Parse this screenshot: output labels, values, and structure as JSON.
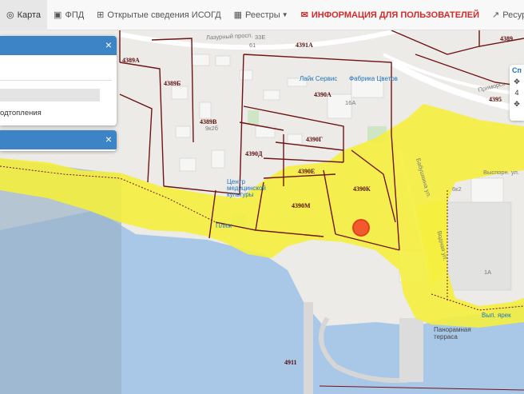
{
  "nav": {
    "items": [
      {
        "label": "Карта",
        "icon": "globe-icon"
      },
      {
        "label": "ФПД",
        "icon": "map-icon"
      },
      {
        "label": "Открытые сведения ИСОГД",
        "icon": "plus-square-icon"
      },
      {
        "label": "Реестры",
        "icon": "table-icon"
      },
      {
        "label": "ИНФОРМАЦИЯ ДЛЯ ПОЛЬЗОВАТЕЛЕЙ",
        "icon": "comments-icon"
      },
      {
        "label": "Ресурсы",
        "icon": "external-link-icon"
      }
    ]
  },
  "panel1": {
    "text": "одтопления",
    "close": "×"
  },
  "panel2": {
    "close": "×"
  },
  "zoom": {
    "label_top": "Сп",
    "label_mid": "4"
  },
  "map": {
    "quarters": [
      "4389А",
      "4389Б",
      "4389В",
      "4390А",
      "4391А",
      "4390Г",
      "4390Д",
      "4390Е",
      "4390К",
      "4390М",
      "4395",
      "4911",
      "4389"
    ],
    "other_labels": [
      "33Е",
      "16А",
      "6к2",
      "1А",
      "9к2б",
      "61"
    ],
    "streets": [
      "Лазурный просп.",
      "Приморск",
      "Бабушкина ул.",
      "Водная ул.",
      "Выспорн. ул."
    ],
    "pois": [
      "Лайк Сервис",
      "Фабрика Цветов",
      "Центр медицинской культуры",
      "Пляж",
      "Панорамная терраса",
      "Вып. ярек"
    ],
    "colors": {
      "zone": "#f5ef3a",
      "boundary": "#6e1414",
      "water": "#a9c8e8",
      "land": "#ecebe7",
      "marker": "#f2592d"
    }
  }
}
